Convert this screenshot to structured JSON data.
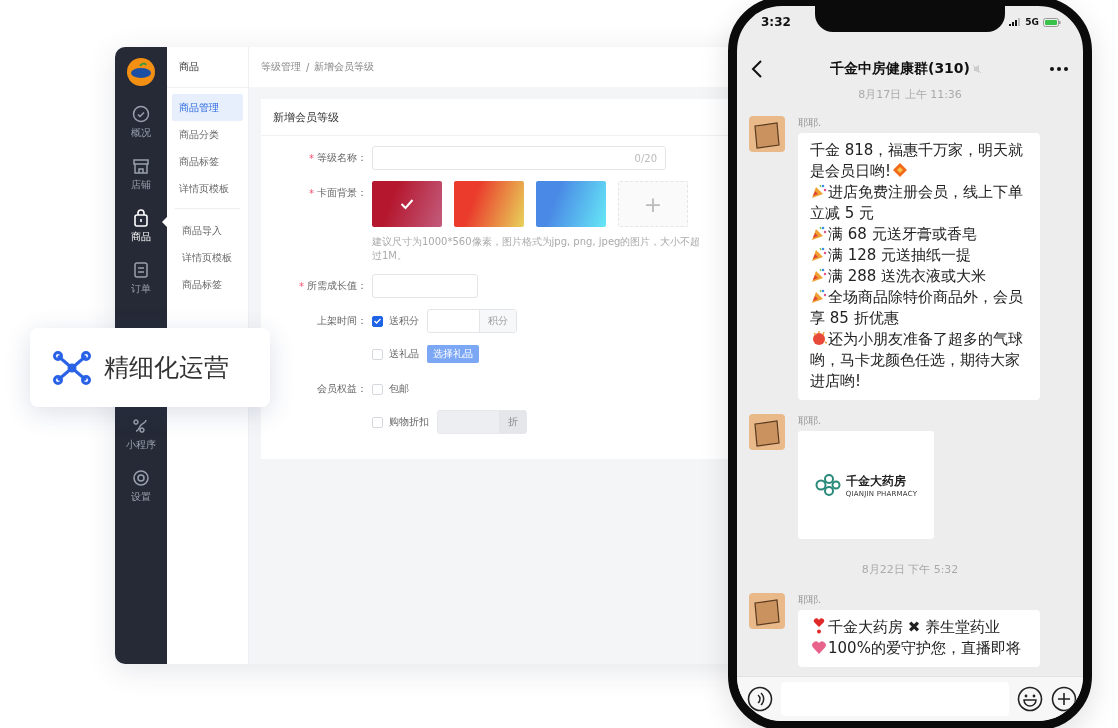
{
  "admin": {
    "sidebar": [
      {
        "label": "概况",
        "selected": false
      },
      {
        "label": "店铺",
        "selected": false
      },
      {
        "label": "商品",
        "selected": true
      },
      {
        "label": "订单",
        "selected": false
      },
      {
        "label": "小程序",
        "selected": false
      },
      {
        "label": "设置",
        "selected": false
      }
    ],
    "nav_title": "商品",
    "nav_groups": [
      [
        {
          "label": "商品管理",
          "selected": true
        },
        {
          "label": "商品分类",
          "selected": false
        },
        {
          "label": "商品标签",
          "selected": false
        },
        {
          "label": "详情页模板",
          "selected": false
        }
      ],
      [
        {
          "label": "商品导入",
          "selected": false
        },
        {
          "label": "详情页模板",
          "selected": false
        },
        {
          "label": "商品标签",
          "selected": false
        }
      ]
    ],
    "breadcrumb": [
      "等级管理",
      "新增会员等级"
    ],
    "breadcrumb_separator": "/",
    "form_title": "新增会员等级",
    "form": [
      {
        "kind": "text",
        "required_mark": "*",
        "label": "等级名称：",
        "counter": "0/20"
      },
      {
        "kind": "swatches",
        "required_mark": "*",
        "label": "卡面背景：",
        "swatches": [
          {
            "color": "#b5172e",
            "selected": true
          },
          {
            "color": "#ea3b2c",
            "selected": false
          },
          {
            "color": "#4a8ae6",
            "selected": false
          }
        ],
        "add": "+",
        "hint": "建议尺寸为1000*560像素，图片格式为jpg, png, jpeg的图片，大小不超过1M。"
      },
      {
        "kind": "input",
        "required_mark": "*",
        "label": "所需成长值："
      },
      {
        "kind": "checks",
        "label": "上架时间：",
        "options": [
          {
            "kind": "addon",
            "label": "送积分",
            "checked": true,
            "addon": "积分",
            "disabled": false
          },
          {
            "kind": "button",
            "label": "送礼品",
            "checked": false,
            "button": "选择礼品"
          }
        ]
      },
      {
        "kind": "checks",
        "label": "会员权益：",
        "options": [
          {
            "kind": "plain",
            "label": "包邮",
            "checked": false
          },
          {
            "kind": "addon",
            "label": "购物折扣",
            "checked": false,
            "addon": "折",
            "disabled": true
          }
        ]
      }
    ]
  },
  "feature_card": {
    "text": "精细化运营"
  },
  "phone": {
    "time": "3:32",
    "network": "5G",
    "title": "千金中房健康群(310)",
    "messages": [
      {
        "kind": "timestamp",
        "text": "8月17日 上午 11:36"
      },
      {
        "kind": "text",
        "sender": "耶耶.",
        "paragraphs": [
          {
            "kind": "announce",
            "text": "千金 818，福惠千万家，明天就是会员日哟!"
          },
          {
            "kind": "promo",
            "text": "进店免费注册会员，线上下单立减 5 元"
          },
          {
            "kind": "promo",
            "text": "满 68 元送牙膏或香皂"
          },
          {
            "kind": "promo",
            "text": "满 128 元送抽纸一提"
          },
          {
            "kind": "promo",
            "text": "满 288 送洗衣液或大米"
          },
          {
            "kind": "promo",
            "text": "全场商品除特价商品外，会员享 85 折优惠"
          },
          {
            "kind": "balloon",
            "text": "还为小朋友准备了超多的气球哟，马卡龙颜色任选，期待大家进店哟!"
          }
        ]
      },
      {
        "kind": "image",
        "sender": "耶耶.",
        "brand": "千金大药房",
        "brand_sub": "QIANJIN PHARMACY"
      },
      {
        "kind": "timestamp",
        "text": "8月22日 下午 5:32"
      },
      {
        "kind": "text",
        "sender": "耶耶.",
        "paragraphs": [
          {
            "kind": "collab",
            "text": "千金大药房 ✖ 养生堂药业"
          },
          {
            "kind": "love",
            "text": "100%的爱守护您，直播即将"
          }
        ]
      }
    ]
  }
}
